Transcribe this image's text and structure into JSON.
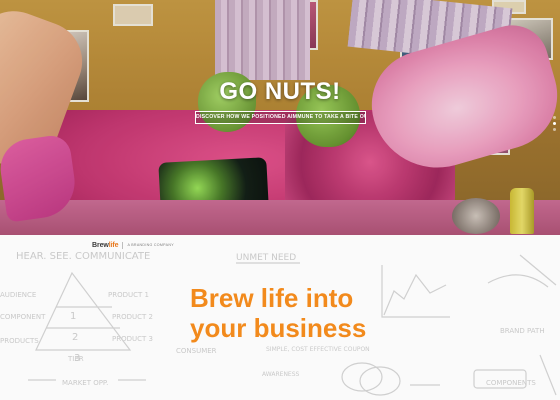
{
  "hero": {
    "title": "GO NUTS!",
    "cta_label": "DISCOVER HOW WE POSITIONED AIMMUNE TO TAKE A BITE OUT OF FOOD",
    "slides_total": 3,
    "active_slide": 2
  },
  "brand": {
    "logo_main": "Brew",
    "logo_accent": "life",
    "tagline": "A BRANDING COMPANY"
  },
  "main": {
    "headline_line1": "Brew life into",
    "headline_line2": "your business"
  },
  "whiteboard": {
    "notes": [
      "HEAR. SEE. COMMUNICATE",
      "UNMET NEED",
      "AUDIENCE",
      "COMPONENT",
      "PRODUCTS",
      "PRODUCT 1",
      "PRODUCT 2",
      "PRODUCT 3",
      "TIER",
      "CONSUMER",
      "SIMPLE, COST EFFECTIVE COUPON",
      "MARKET OPP.",
      "AWARENESS",
      "COMPONENTS",
      "BRAND PATH"
    ],
    "pyramid_tiers": [
      "1",
      "2",
      "3"
    ]
  },
  "colors": {
    "accent_orange": "#f28a1c",
    "hero_text": "#ffffff"
  }
}
